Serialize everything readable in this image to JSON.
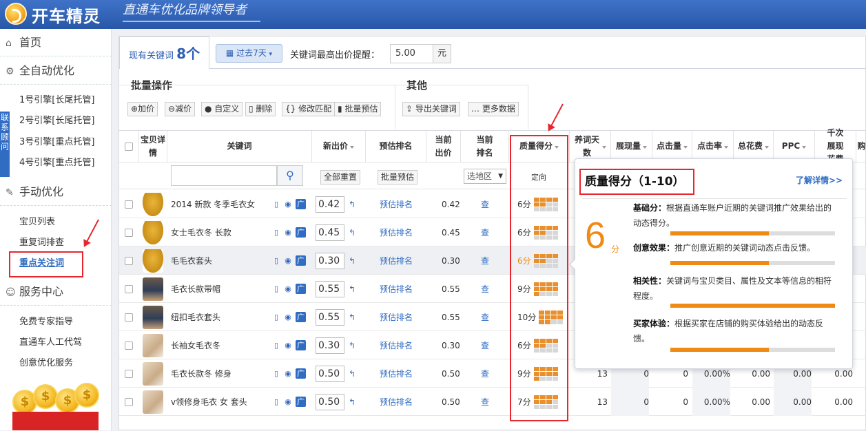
{
  "app": {
    "logo_text": "开车精灵",
    "slogan": "直通车优化品牌领导者"
  },
  "sidebar": {
    "home": "首页",
    "auto": "全自动优化",
    "engines": [
      "1号引擎[长尾托管]",
      "2号引擎[长尾托管]",
      "3号引擎[重点托管]",
      "4号引擎[重点托管]"
    ],
    "contact": "联系顾问",
    "manual": "手动优化",
    "manual_items": [
      "宝贝列表",
      "重复词排查",
      "重点关注词"
    ],
    "service": "服务中心",
    "service_items": [
      "免费专家指导",
      "直通车人工代驾",
      "创意优化服务"
    ]
  },
  "toolbar": {
    "tab_label": "现有关键词",
    "tab_count": "8个",
    "date_range": "过去7天",
    "bid_label": "关键词最高出价提醒：",
    "bid_value": "5.00",
    "bid_unit": "元"
  },
  "batch": {
    "title": "批量操作",
    "buttons": [
      "加价",
      "减价",
      "自定义",
      "删除",
      "修改匹配",
      "批量预估"
    ]
  },
  "other": {
    "title": "其他",
    "buttons": [
      "导出关键词",
      "更多数据"
    ]
  },
  "table": {
    "headers": [
      "宝贝详情",
      "关键词",
      "新出价",
      "预估排名",
      "当前出价",
      "当前排名",
      "质量得分",
      "养词天数",
      "展现量",
      "点击量",
      "点击率",
      "总花费",
      "PPC",
      "千次展现花费",
      "购"
    ],
    "filter": {
      "reset_all": "全部重置",
      "batch_estimate": "批量预估",
      "region_select": "选地区",
      "targeting": "定向"
    },
    "rows": [
      {
        "keyword": "2014 新款 冬季毛衣女",
        "new_bid": "0.42",
        "estimate": "预估排名",
        "cur_bid": "0.42",
        "rank": "查",
        "score": "6分",
        "score_num": 6,
        "thumb": "yellow",
        "days": "",
        "imp": "",
        "clicks": "",
        "ctr": "",
        "cost": "",
        "ppc": "",
        "cpm": ""
      },
      {
        "keyword": "女士毛衣冬 长款",
        "new_bid": "0.45",
        "estimate": "预估排名",
        "cur_bid": "0.45",
        "rank": "查",
        "score": "6分",
        "score_num": 6,
        "thumb": "yellow",
        "days": "",
        "imp": "",
        "clicks": "",
        "ctr": "",
        "cost": "",
        "ppc": "",
        "cpm": ""
      },
      {
        "keyword": "毛毛衣套头",
        "new_bid": "0.30",
        "estimate": "预估排名",
        "cur_bid": "0.30",
        "rank": "查",
        "score": "6分",
        "score_num": 6,
        "thumb": "yellow",
        "days": "",
        "imp": "",
        "clicks": "",
        "ctr": "",
        "cost": "",
        "ppc": "",
        "cpm": ""
      },
      {
        "keyword": "毛衣长款带帽",
        "new_bid": "0.55",
        "estimate": "预估排名",
        "cur_bid": "0.55",
        "rank": "查",
        "score": "9分",
        "score_num": 9,
        "thumb": "model",
        "days": "",
        "imp": "",
        "clicks": "",
        "ctr": "",
        "cost": "",
        "ppc": "",
        "cpm": ""
      },
      {
        "keyword": "纽扣毛衣套头",
        "new_bid": "0.55",
        "estimate": "预估排名",
        "cur_bid": "0.55",
        "rank": "查",
        "score": "10分",
        "score_num": 10,
        "thumb": "model",
        "days": "",
        "imp": "",
        "clicks": "",
        "ctr": "",
        "cost": "",
        "ppc": "",
        "cpm": ""
      },
      {
        "keyword": "长袖女毛衣冬",
        "new_bid": "0.30",
        "estimate": "预估排名",
        "cur_bid": "0.30",
        "rank": "查",
        "score": "6分",
        "score_num": 6,
        "thumb": "beige",
        "days": "",
        "imp": "",
        "clicks": "",
        "ctr": "",
        "cost": "",
        "ppc": "",
        "cpm": ""
      },
      {
        "keyword": "毛衣长款冬 修身",
        "new_bid": "0.50",
        "estimate": "预估排名",
        "cur_bid": "0.50",
        "rank": "查",
        "score": "9分",
        "score_num": 9,
        "thumb": "beige",
        "days": "13",
        "imp": "0",
        "clicks": "0",
        "ctr": "0.00%",
        "cost": "0.00",
        "ppc": "0.00",
        "cpm": "0.00"
      },
      {
        "keyword": "v领修身毛衣 女 套头",
        "new_bid": "0.50",
        "estimate": "预估排名",
        "cur_bid": "0.50",
        "rank": "查",
        "score": "7分",
        "score_num": 7,
        "thumb": "beige",
        "days": "13",
        "imp": "0",
        "clicks": "0",
        "ctr": "0.00%",
        "cost": "0.00",
        "ppc": "0.00",
        "cpm": "0.00"
      }
    ]
  },
  "popover": {
    "title": "质量得分（1-10）",
    "link": "了解详情>>",
    "score": "6",
    "unit": "分",
    "items": [
      {
        "label": "基础分：",
        "text": "根据直通车账户近期的关键词推广效果给出的动态得分。",
        "level": 0.6
      },
      {
        "label": "创意效果：",
        "text": "推广创意近期的关键词动态点击反馈。",
        "level": 0.6
      },
      {
        "label": "相关性：",
        "text": "关键词与宝贝类目、属性及文本等信息的相符程度。",
        "level": 1.0
      },
      {
        "label": "买家体验：",
        "text": "根据买家在店铺的购买体验给出的动态反馈。",
        "level": 0.6
      }
    ]
  },
  "colors": {
    "accent": "#2f6cc2",
    "header": "#3565b9",
    "highlight_red": "#e8262d",
    "score_orange": "#f08a15"
  }
}
